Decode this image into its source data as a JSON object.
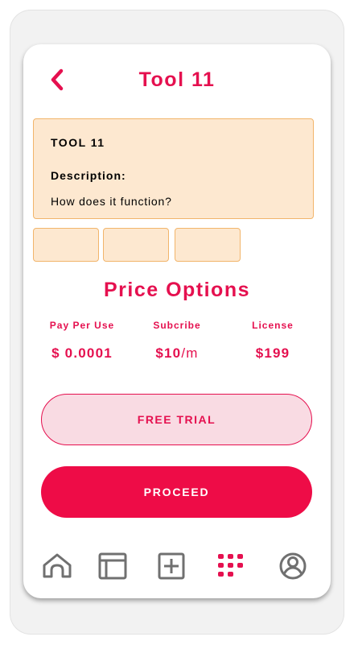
{
  "header": {
    "title": "Tool 11",
    "back_icon": "chevron-left-icon"
  },
  "info_card": {
    "name": "TOOL 11",
    "description_label": "Description:",
    "description": "How does it function?"
  },
  "thumbnails_count": 3,
  "pricing": {
    "title": "Price Options",
    "options": [
      {
        "label": "Pay Per Use",
        "value": "$ 0.0001",
        "unit": ""
      },
      {
        "label": "Subcribe",
        "value": "$10",
        "unit": "/m"
      },
      {
        "label": "License",
        "value": "$199",
        "unit": ""
      }
    ]
  },
  "buttons": {
    "free_trial": "FREE TRIAL",
    "proceed": "PROCEED"
  },
  "bottom_nav": {
    "items": [
      {
        "icon": "home-icon",
        "active": false
      },
      {
        "icon": "browser-window-icon",
        "active": false
      },
      {
        "icon": "add-square-icon",
        "active": false
      },
      {
        "icon": "apps-grid-icon",
        "active": true
      },
      {
        "icon": "user-profile-icon",
        "active": false
      }
    ]
  },
  "colors": {
    "accent": "#e5104f",
    "proceed_bg": "#ee0c47",
    "trial_bg": "#f9dbe3",
    "card_bg": "#fde8d0",
    "card_border": "#f2b56b",
    "nav_inactive": "#707070"
  }
}
